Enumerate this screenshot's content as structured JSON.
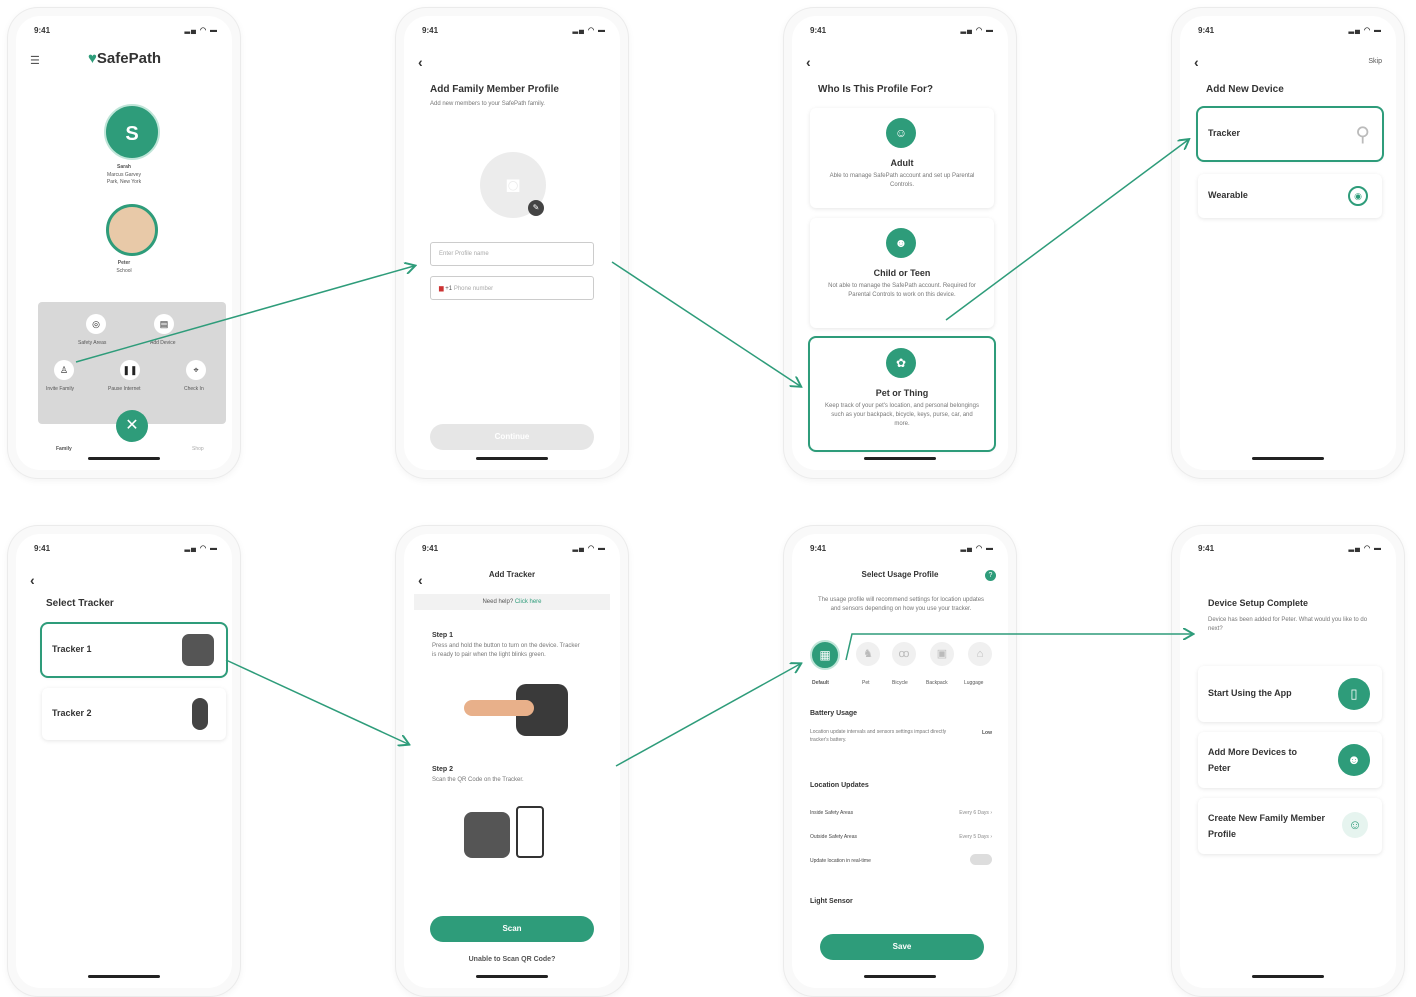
{
  "status": {
    "time": "9:41",
    "icons": "▂▄ ◠ ▬"
  },
  "s1": {
    "brand": "SafePath",
    "avatar_letter": "S",
    "name1": "Sarah",
    "place1a": "Marcus Garvey",
    "place1b": "Park, New York",
    "name2": "Peter",
    "place2": "School",
    "menu": [
      "Safety Areas",
      "Add Device",
      "Invite Family",
      "Pause Internet",
      "Check In"
    ],
    "nav_family": "Family",
    "nav_shop": "Shop"
  },
  "s2": {
    "title": "Add Family Member Profile",
    "sub": "Add new members to your SafePath family.",
    "name_ph": "Enter Profile name",
    "code": "+1",
    "phone_ph": "Phone number",
    "next": "Continue"
  },
  "s3": {
    "title": "Who Is This Profile For?",
    "opts": [
      {
        "t": "Adult",
        "d": "Able to manage SafePath account and set up Parental Controls."
      },
      {
        "t": "Child or Teen",
        "d": "Not able to manage the SafePath account. Required for Parental Controls to work on this device."
      },
      {
        "t": "Pet or Thing",
        "d": "Keep track of your pet's location, and personal belongings such as your backpack, bicycle, keys, purse, car, and more."
      }
    ]
  },
  "s4": {
    "skip": "Skip",
    "title": "Add New Device",
    "items": [
      "Tracker",
      "Wearable"
    ]
  },
  "s5": {
    "title": "Select Tracker",
    "items": [
      "Tracker 1",
      "Tracker 2"
    ]
  },
  "s6": {
    "title": "Add Tracker",
    "help": "Need help?",
    "help_link": "Click here",
    "step1": "Step 1",
    "step1_d": "Press and hold the button to turn on the device. Tracker is ready to pair when the light blinks green.",
    "step2": "Step 2",
    "step2_d": "Scan the QR Code on the Tracker.",
    "scan": "Scan",
    "unable": "Unable to Scan QR Code?"
  },
  "s7": {
    "title": "Select Usage Profile",
    "desc": "The usage profile will recommend settings for location updates and sensors depending on how you use your tracker.",
    "profiles": [
      "Default",
      "Pet",
      "Bicycle",
      "Backpack",
      "Luggage"
    ],
    "battery": "Battery Usage",
    "battery_d": "Location update intervals and sensors settings impact directly tracker's battery.",
    "battery_v": "Low",
    "loc": "Location Updates",
    "inside": "Inside Safety Areas",
    "inside_v": "Every 6 Days",
    "outside": "Outside Safety Areas",
    "outside_v": "Every 5 Days",
    "realtime": "Update location in real-time",
    "light": "Light Sensor",
    "save": "Save"
  },
  "s8": {
    "title": "Device Setup Complete",
    "desc": "Device has been added for Peter. What would you like to do next?",
    "opts": [
      "Start Using the App",
      "Add More Devices to Peter",
      "Create New Family Member Profile"
    ]
  },
  "colors": {
    "accent": "#2e9c7a"
  }
}
